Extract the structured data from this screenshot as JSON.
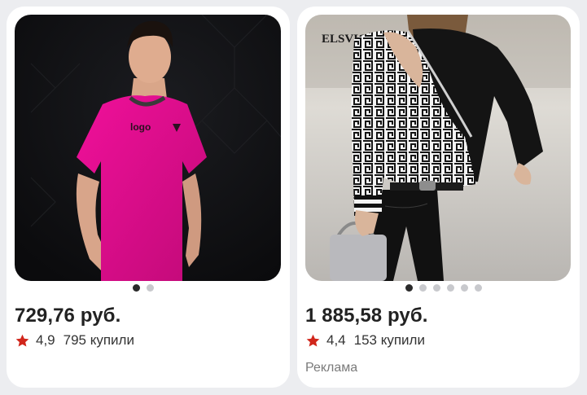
{
  "products": [
    {
      "price": "729,76 руб.",
      "rating": "4,9",
      "bought": "795 купили",
      "image_icon": "product-photo-pink-tshirt",
      "shirt_print": "logo",
      "gallery_pages": 2,
      "gallery_current": 1
    },
    {
      "price": "1 885,58 руб.",
      "rating": "4,4",
      "bought": "153 купили",
      "ad_label": "Реклама",
      "image_icon": "product-photo-patterned-blouse",
      "brand_print": "ELSVIOS",
      "gallery_pages": 6,
      "gallery_current": 1
    }
  ],
  "colors": {
    "star": "#d1261b",
    "card_bg": "#ffffff",
    "page_bg": "#ecedf0"
  }
}
